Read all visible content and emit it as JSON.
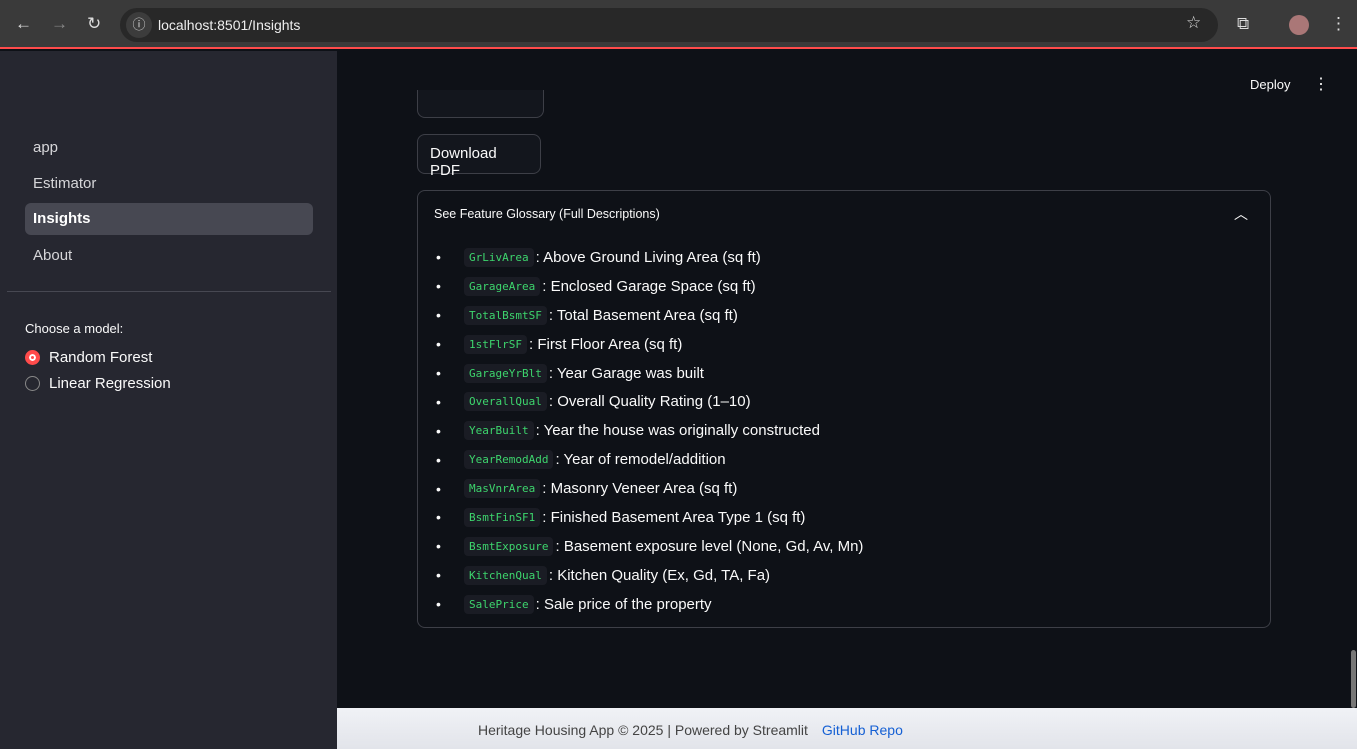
{
  "browser": {
    "url": "localhost:8501/Insights"
  },
  "sidebar": {
    "items": [
      {
        "label": "app"
      },
      {
        "label": "Estimator"
      },
      {
        "label": "Insights"
      },
      {
        "label": "About"
      }
    ],
    "model_label": "Choose a model:",
    "models": [
      "Random Forest",
      "Linear Regression"
    ],
    "selected": "Random Forest"
  },
  "header": {
    "deploy": "Deploy"
  },
  "main": {
    "download_pdf": "Download PDF",
    "glossary": {
      "title": "See Feature Glossary (Full Descriptions)",
      "items": [
        {
          "code": "GrLivArea",
          "desc": ": Above Ground Living Area (sq ft)"
        },
        {
          "code": "GarageArea",
          "desc": ": Enclosed Garage Space (sq ft)"
        },
        {
          "code": "TotalBsmtSF",
          "desc": ": Total Basement Area (sq ft)"
        },
        {
          "code": "1stFlrSF",
          "desc": ": First Floor Area (sq ft)"
        },
        {
          "code": "GarageYrBlt",
          "desc": ": Year Garage was built"
        },
        {
          "code": "OverallQual",
          "desc": ": Overall Quality Rating (1–10)"
        },
        {
          "code": "YearBuilt",
          "desc": ": Year the house was originally constructed"
        },
        {
          "code": "YearRemodAdd",
          "desc": ": Year of remodel/addition"
        },
        {
          "code": "MasVnrArea",
          "desc": ": Masonry Veneer Area (sq ft)"
        },
        {
          "code": "BsmtFinSF1",
          "desc": ": Finished Basement Area Type 1 (sq ft)"
        },
        {
          "code": "BsmtExposure",
          "desc": ": Basement exposure level (None, Gd, Av, Mn)"
        },
        {
          "code": "KitchenQual",
          "desc": ": Kitchen Quality (Ex, Gd, TA, Fa)"
        },
        {
          "code": "SalePrice",
          "desc": ": Sale price of the property"
        }
      ]
    }
  },
  "footer": {
    "text": "Heritage Housing App © 2025 | Powered by Streamlit",
    "link": "GitHub Repo"
  }
}
